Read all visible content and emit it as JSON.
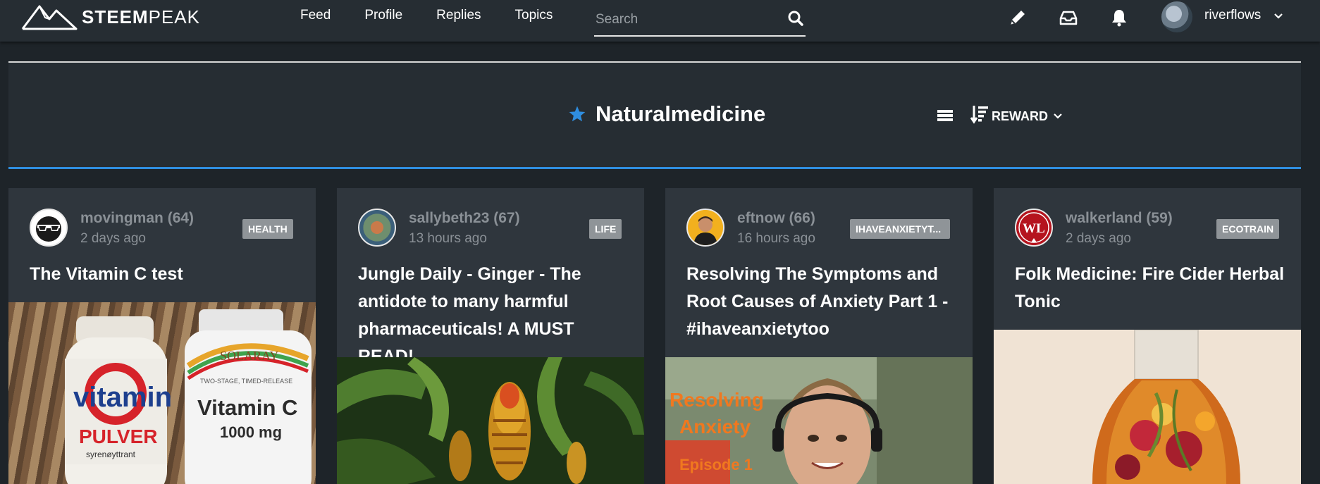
{
  "logo": {
    "text_bold": "STEEM",
    "text_light": "PEAK"
  },
  "nav": {
    "items": [
      {
        "label": "Feed"
      },
      {
        "label": "Profile"
      },
      {
        "label": "Replies"
      },
      {
        "label": "Topics"
      }
    ]
  },
  "search": {
    "placeholder": "Search",
    "value": ""
  },
  "user": {
    "username": "riverflows"
  },
  "header": {
    "title": "Naturalmedicine",
    "sort_label": "REWARD"
  },
  "colors": {
    "accent": "#2f8ee0",
    "panel": "#262d33",
    "card": "#2f363d",
    "tag": "#8f9498"
  },
  "cards": [
    {
      "author": "movingman",
      "reputation": "(64)",
      "time": "2 days ago",
      "tag": "HEALTH",
      "title": "The Vitamin C test",
      "thumb_labels": {
        "left_brand": "vitamin",
        "left_sub": "PULVER",
        "left_small": "syrenøyttrant",
        "right_brand": "SOLARAY",
        "right_line1": "Vitamin C",
        "right_line2": "1000 mg",
        "right_small": "TWO-STAGE, TIMED-RELEASE"
      }
    },
    {
      "author": "sallybeth23",
      "reputation": "(67)",
      "time": "13 hours ago",
      "tag": "LIFE",
      "title": "Jungle Daily - Ginger - The antidote to many harmful pharmaceuticals! A MUST READ!"
    },
    {
      "author": "eftnow",
      "reputation": "(66)",
      "time": "16 hours ago",
      "tag": "IHAVEANXIETYT...",
      "title": "Resolving The Symptoms and Root Causes of Anxiety Part 1 - #ihaveanxietytoo",
      "thumb_labels": {
        "line1": "Resolving",
        "line2": "Anxiety",
        "line3": "Episode 1"
      }
    },
    {
      "author": "walkerland",
      "reputation": "(59)",
      "time": "2 days ago",
      "tag": "ECOTRAIN",
      "title": "Folk Medicine: Fire Cider Herbal Tonic",
      "avatar_text": "WL"
    }
  ]
}
